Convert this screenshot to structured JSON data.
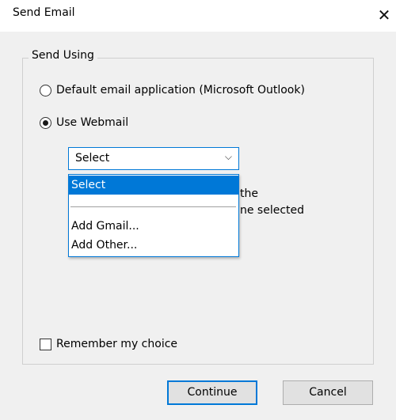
{
  "window": {
    "title": "Send Email",
    "close_glyph": "✕",
    "close_icon": "close-icon"
  },
  "group": {
    "legend": "Send Using"
  },
  "options": {
    "default_app_label": "Default email application (Microsoft Outlook)",
    "default_app_checked": false,
    "webmail_label": "Use Webmail",
    "webmail_checked": true
  },
  "webmail_select": {
    "value": "Select",
    "arrow_glyph": "⌵",
    "arrow_icon": "chevron-down-icon",
    "items": [
      "Select",
      "",
      "Add Gmail...",
      "Add Other..."
    ],
    "selected_index": 0
  },
  "partially_hidden_text": {
    "line1": "the",
    "line2": "ne selected"
  },
  "remember": {
    "label": "Remember my choice",
    "checked": false
  },
  "buttons": {
    "continue": "Continue",
    "cancel": "Cancel"
  },
  "colors": {
    "accent": "#0078d7",
    "background": "#f0f0f0"
  }
}
